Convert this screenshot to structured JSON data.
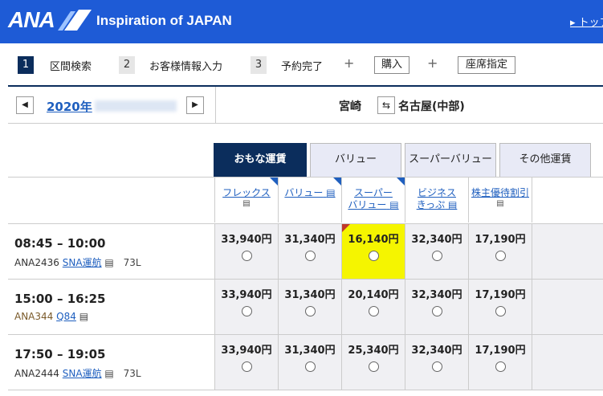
{
  "header": {
    "logo_text": "ANA",
    "tagline": "Inspiration of JAPAN",
    "top_link": "▸ トップ",
    "brand_color": "#1e5bd6"
  },
  "steps": [
    {
      "num": "1",
      "label": "区間検索"
    },
    {
      "num": "2",
      "label": "お客様情報入力"
    },
    {
      "num": "3",
      "label": "予約完了"
    }
  ],
  "extras": {
    "plus": "+",
    "purchase": "購入",
    "seat": "座席指定"
  },
  "datebar": {
    "prev_icon": "◀",
    "next_icon": "▶",
    "date_label": "2020年",
    "origin": "宮崎",
    "swap_icon": "⇆",
    "destination": "名古屋(中部)"
  },
  "tabs": [
    "おもな運賃",
    "バリュー",
    "スーパーバリュー",
    "その他運賃"
  ],
  "fare_headers": [
    {
      "line1": "フレックス",
      "line2": ""
    },
    {
      "line1": "バリュー",
      "line2": ""
    },
    {
      "line1": "スーパー",
      "line2": "バリュー"
    },
    {
      "line1": "ビジネス",
      "line2": "きっぷ"
    },
    {
      "line1": "株主優待割引",
      "line2": ""
    }
  ],
  "flights": [
    {
      "time": "08:45 – 10:00",
      "code": "ANA2436",
      "operator": "SNA運航",
      "aircraft": "73L",
      "prices": [
        "33,940円",
        "31,340円",
        "16,140円",
        "32,340円",
        "17,190円"
      ]
    },
    {
      "time": "15:00 – 16:25",
      "code": "ANA344",
      "operator": "Q84",
      "aircraft": "",
      "prices": [
        "33,940円",
        "31,340円",
        "20,140円",
        "32,340円",
        "17,190円"
      ]
    },
    {
      "time": "17:50 – 19:05",
      "code": "ANA2444",
      "operator": "SNA運航",
      "aircraft": "73L",
      "prices": [
        "33,940円",
        "31,340円",
        "25,340円",
        "32,340円",
        "17,190円"
      ]
    }
  ],
  "icons": {
    "info": "▤"
  },
  "colors": {
    "navy": "#0b2d5c",
    "highlight": "#f5f500",
    "link": "#1f5fbf"
  }
}
